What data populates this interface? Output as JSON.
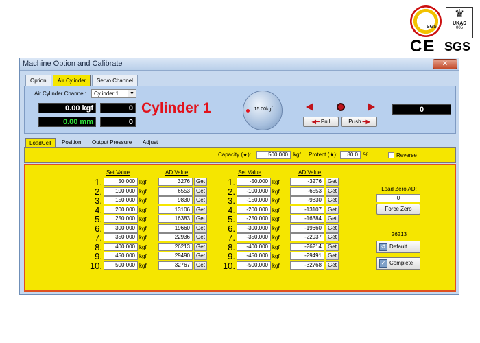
{
  "branding": {
    "sgs_badge_text": "SGS",
    "ukas_text": "UKAS",
    "ukas_number": "005",
    "ce_mark": "CE",
    "sgs_mark": "SGS"
  },
  "window": {
    "title": "Machine Option and Calibrate",
    "close_label": "✕"
  },
  "top_tabs": [
    {
      "label": "Option"
    },
    {
      "label": "Air Cylinder"
    },
    {
      "label": "Servo Channel"
    }
  ],
  "cylinder": {
    "channel_label": "Air Cylinder Channel:",
    "channel_value": "Cylinder 1",
    "force_reading": "0.00 kgf",
    "force_counter": "0",
    "disp_reading": "0.00 mm",
    "disp_counter": "0",
    "title": "Cylinder 1",
    "knob_value": "15.00kgf",
    "pull_label": "Pull",
    "push_label": "Push",
    "right_counter": "0"
  },
  "mid_tabs": [
    {
      "label": "LoadCell"
    },
    {
      "label": "Position"
    },
    {
      "label": "Output Pressure"
    },
    {
      "label": "Adjust"
    }
  ],
  "capacity": {
    "capacity_label": "Capacity (★):",
    "capacity_value": "500.000",
    "capacity_unit": "kgf",
    "protect_label": "Protect (★):",
    "protect_value": "80.0",
    "protect_unit": "%",
    "reverse_label": "Reverse"
  },
  "table": {
    "set_header": "Set Value",
    "ad_header": "AD Value",
    "unit": "kgf",
    "get_label": "Get",
    "positive": [
      {
        "n": "1.",
        "set": "50.000",
        "ad": "3276"
      },
      {
        "n": "2.",
        "set": "100.000",
        "ad": "6553"
      },
      {
        "n": "3.",
        "set": "150.000",
        "ad": "9830"
      },
      {
        "n": "4.",
        "set": "200.000",
        "ad": "13106"
      },
      {
        "n": "5.",
        "set": "250.000",
        "ad": "16383"
      },
      {
        "n": "6.",
        "set": "300.000",
        "ad": "19660"
      },
      {
        "n": "7.",
        "set": "350.000",
        "ad": "22936"
      },
      {
        "n": "8.",
        "set": "400.000",
        "ad": "26213"
      },
      {
        "n": "9.",
        "set": "450.000",
        "ad": "29490"
      },
      {
        "n": "10.",
        "set": "500.000",
        "ad": "32767"
      }
    ],
    "negative": [
      {
        "n": "1.",
        "set": "-50.000",
        "ad": "-3276"
      },
      {
        "n": "2.",
        "set": "-100.000",
        "ad": "-6553"
      },
      {
        "n": "3.",
        "set": "-150.000",
        "ad": "-9830"
      },
      {
        "n": "4.",
        "set": "-200.000",
        "ad": "-13107"
      },
      {
        "n": "5.",
        "set": "-250.000",
        "ad": "-16384"
      },
      {
        "n": "6.",
        "set": "-300.000",
        "ad": "-19660"
      },
      {
        "n": "7.",
        "set": "-350.000",
        "ad": "-22937"
      },
      {
        "n": "8.",
        "set": "-400.000",
        "ad": "-26214"
      },
      {
        "n": "9.",
        "set": "-450.000",
        "ad": "-29491"
      },
      {
        "n": "10.",
        "set": "-500.000",
        "ad": "-32768"
      }
    ]
  },
  "side": {
    "load_zero_label": "Load Zero AD:",
    "load_zero_value": "0",
    "force_zero_label": "Force Zero",
    "current_ad": "26213",
    "default_label": "Default",
    "complete_label": "Complete"
  },
  "colors": {
    "panel_yellow": "#f5e600",
    "panel_blue": "#b8d0ee",
    "accent_red": "#e2121b",
    "lcd_green": "#31e33a"
  }
}
